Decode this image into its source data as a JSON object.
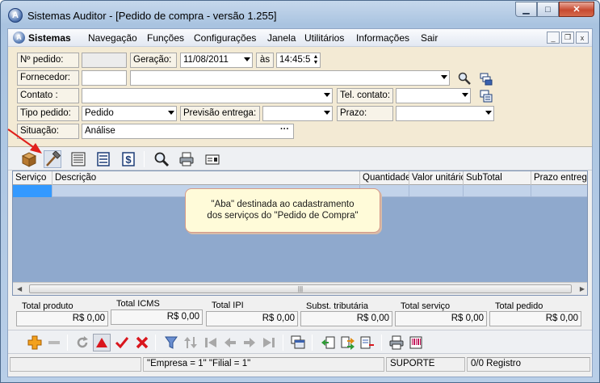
{
  "window": {
    "title": "Sistemas Auditor - [Pedido de compra - versão 1.255]",
    "app_icon_letter": "A",
    "caption_buttons": {
      "minimize": "▁",
      "maximize": "□",
      "close": "✕"
    }
  },
  "menu": {
    "items": [
      "Sistemas",
      "Navegação",
      "Funções",
      "Configurações",
      "Janela",
      "Utilitários",
      "Informações",
      "Sair"
    ],
    "mdi_buttons": {
      "minimize": "_",
      "restore": "❐",
      "close": "x"
    }
  },
  "form": {
    "pedido_label": "Nº pedido:",
    "pedido_value": "",
    "geracao_label": "Geração:",
    "geracao_date": "11/08/2011",
    "as_label": "às",
    "geracao_time": "14:45:5",
    "fornecedor_label": "Fornecedor:",
    "fornecedor_code": "",
    "fornecedor_name": "",
    "contato_label": "Contato :",
    "contato_value": "",
    "tel_contato_label": "Tel. contato:",
    "tel_contato_value": "",
    "tipo_pedido_label": "Tipo pedido:",
    "tipo_pedido_value": "Pedido",
    "previsao_label": "Previsão entrega:",
    "previsao_value": "",
    "prazo_label": "Prazo:",
    "prazo_code": "",
    "prazo_value": "",
    "situacao_label": "Situação:",
    "situacao_value": "Análise",
    "ellipsis": "···"
  },
  "grid": {
    "columns": [
      "Serviço",
      "Descrição",
      "Quantidade",
      "Valor unitário",
      "SubTotal",
      "Prazo entrega"
    ],
    "scroll_grip": "|||"
  },
  "note": {
    "line1": "\"Aba\" destinada ao cadastramento",
    "line2": "dos serviços do \"Pedido de Compra\""
  },
  "totals": [
    {
      "label": "Total produto",
      "value": "R$ 0,00"
    },
    {
      "label": "Total ICMS",
      "value": "R$ 0,00"
    },
    {
      "label": "Total IPI",
      "value": "R$ 0,00"
    },
    {
      "label": "Subst. tributária",
      "value": "R$ 0,00"
    },
    {
      "label": "Total serviço",
      "value": "R$ 0,00"
    },
    {
      "label": "Total pedido",
      "value": "R$ 0,00"
    }
  ],
  "status": {
    "empresa_filial": "\"Empresa = 1\"   \"Filial = 1\"",
    "user": "SUPORTE",
    "records": "0/0 Registro"
  },
  "colors": {
    "form_bg": "#f3ead4",
    "grid_bg": "#8fa9cd",
    "selected_cell": "#3399ff",
    "note_bg": "#fffbd9",
    "arrow": "#e0201b"
  }
}
